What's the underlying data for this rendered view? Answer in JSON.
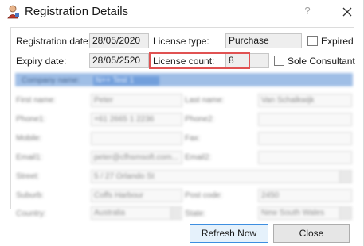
{
  "window": {
    "title": "Registration Details",
    "help_label": "?",
    "close_icon": "close-icon",
    "app_icon": "user-icon"
  },
  "form": {
    "registration_date_label": "Registration date:",
    "registration_date_value": "28/05/2020",
    "license_type_label": "License type:",
    "license_type_value": "Purchase",
    "expired_label": "Expired",
    "expired_checked": false,
    "expiry_date_label": "Expiry date:",
    "expiry_date_value": "28/05/2520",
    "license_count_label": "License count:",
    "license_count_value": "8",
    "sole_consultant_label": "Sole Consultant",
    "sole_consultant_checked": false
  },
  "blurred_section": {
    "company_name_label": "Company name:",
    "company_name_value": "N++ Test 1",
    "first_name_label": "First name:",
    "first_name_value": "Peter",
    "last_name_label": "Last name:",
    "last_name_value": "Van Schalkwijk",
    "phone1_label": "Phone1:",
    "phone1_value": "+61 2665 1 2236",
    "phone2_label": "Phone2:",
    "mobile_label": "Mobile:",
    "fax_label": "Fax:",
    "email1_label": "Email1:",
    "email1_value": "peter@cfhsmsoft.com...",
    "email2_label": "Email2:",
    "street_label": "Street:",
    "street_value": "5 / 27 Orlando St",
    "suburb_label": "Suburb:",
    "suburb_value": "Coffs Harbour",
    "post_code_label": "Post code:",
    "post_code_value": "2450",
    "country_label": "Country:",
    "country_value": "Australia",
    "state_label": "State:",
    "state_value": "New South Wales"
  },
  "buttons": {
    "refresh_label": "Refresh Now",
    "close_label": "Close"
  },
  "colors": {
    "highlight_border": "#e05252",
    "selection_blue": "#8fb3e2",
    "primary_button_border": "#3d8ee0"
  }
}
